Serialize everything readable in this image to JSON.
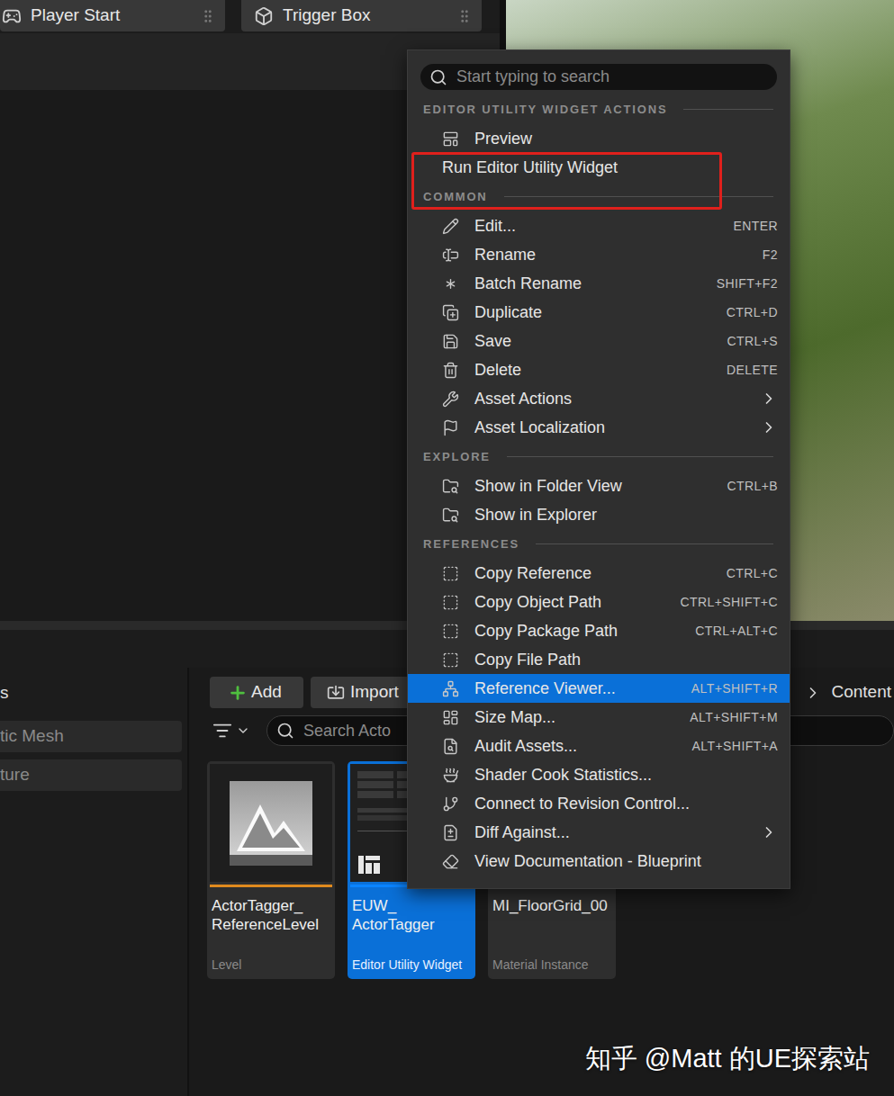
{
  "toolbar": {
    "items": [
      {
        "label": "Player Start"
      },
      {
        "label": "Trigger Box"
      }
    ]
  },
  "content_browser": {
    "sidebar": {
      "heading": "s",
      "items": [
        {
          "label": "tic Mesh"
        },
        {
          "label": "ture"
        }
      ]
    },
    "add_button": "Add",
    "import_button": "Import",
    "search": {
      "placeholder": "Search Acto"
    },
    "breadcrumb": [
      "Content"
    ],
    "assets": [
      {
        "name": "ActorTagger_ReferenceLevel",
        "type": "Level",
        "selected": false,
        "color": "#e08a1e",
        "kind": "level"
      },
      {
        "name": "EUW_ActorTagger",
        "type": "Editor Utility Widget",
        "selected": true,
        "color": "#0a84ff",
        "kind": "widget"
      },
      {
        "name": "MI_FloorGrid_00",
        "type": "Material Instance",
        "selected": false,
        "color": "#5a8a3a",
        "kind": "material"
      }
    ]
  },
  "context_menu": {
    "search": {
      "placeholder": "Start typing to search"
    },
    "sections": [
      {
        "heading": "EDITOR UTILITY WIDGET ACTIONS",
        "items": [
          {
            "label": "Preview",
            "shortcut": "",
            "submenu": false,
            "selected": false,
            "annotated": false
          },
          {
            "label": "Run Editor Utility Widget",
            "shortcut": "",
            "submenu": false,
            "selected": false,
            "annotated": true
          }
        ]
      },
      {
        "heading": "COMMON",
        "items": [
          {
            "label": "Edit...",
            "shortcut": "ENTER",
            "submenu": false,
            "selected": false,
            "annotated": false
          },
          {
            "label": "Rename",
            "shortcut": "F2",
            "submenu": false,
            "selected": false,
            "annotated": false
          },
          {
            "label": "Batch Rename",
            "shortcut": "SHIFT+F2",
            "submenu": false,
            "selected": false,
            "annotated": false
          },
          {
            "label": "Duplicate",
            "shortcut": "CTRL+D",
            "submenu": false,
            "selected": false,
            "annotated": false
          },
          {
            "label": "Save",
            "shortcut": "CTRL+S",
            "submenu": false,
            "selected": false,
            "annotated": false
          },
          {
            "label": "Delete",
            "shortcut": "DELETE",
            "submenu": false,
            "selected": false,
            "annotated": false
          },
          {
            "label": "Asset Actions",
            "shortcut": "",
            "submenu": true,
            "selected": false,
            "annotated": false
          },
          {
            "label": "Asset Localization",
            "shortcut": "",
            "submenu": true,
            "selected": false,
            "annotated": false
          }
        ]
      },
      {
        "heading": "EXPLORE",
        "items": [
          {
            "label": "Show in Folder View",
            "shortcut": "CTRL+B",
            "submenu": false,
            "selected": false,
            "annotated": false
          },
          {
            "label": "Show in Explorer",
            "shortcut": "",
            "submenu": false,
            "selected": false,
            "annotated": false
          }
        ]
      },
      {
        "heading": "REFERENCES",
        "items": [
          {
            "label": "Copy Reference",
            "shortcut": "CTRL+C",
            "submenu": false,
            "selected": false,
            "annotated": false
          },
          {
            "label": "Copy Object Path",
            "shortcut": "CTRL+SHIFT+C",
            "submenu": false,
            "selected": false,
            "annotated": false
          },
          {
            "label": "Copy Package Path",
            "shortcut": "CTRL+ALT+C",
            "submenu": false,
            "selected": false,
            "annotated": false
          },
          {
            "label": "Copy File Path",
            "shortcut": "",
            "submenu": false,
            "selected": false,
            "annotated": false
          },
          {
            "label": "Reference Viewer...",
            "shortcut": "ALT+SHIFT+R",
            "submenu": false,
            "selected": true,
            "annotated": false
          },
          {
            "label": "Size Map...",
            "shortcut": "ALT+SHIFT+M",
            "submenu": false,
            "selected": false,
            "annotated": false
          },
          {
            "label": "Audit Assets...",
            "shortcut": "ALT+SHIFT+A",
            "submenu": false,
            "selected": false,
            "annotated": false
          },
          {
            "label": "Shader Cook Statistics...",
            "shortcut": "",
            "submenu": false,
            "selected": false,
            "annotated": false
          },
          {
            "label": "Connect to Revision Control...",
            "shortcut": "",
            "submenu": false,
            "selected": false,
            "annotated": false
          },
          {
            "label": "Diff Against...",
            "shortcut": "",
            "submenu": true,
            "selected": false,
            "annotated": false
          },
          {
            "label": "View Documentation - Blueprint",
            "shortcut": "",
            "submenu": false,
            "selected": false,
            "annotated": false
          }
        ]
      }
    ]
  },
  "watermark": "知乎 @Matt 的UE探索站"
}
